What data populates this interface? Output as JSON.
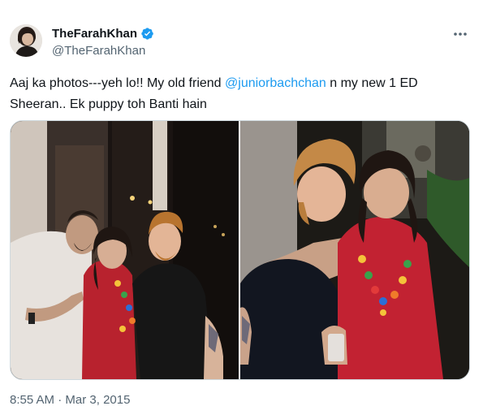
{
  "tweet": {
    "display_name": "TheFarahKhan",
    "handle": "@TheFarahKhan",
    "text_part1": "Aaj ka photos---yeh lo!! My old friend ",
    "mention": "@juniorbachchan",
    "text_part2": " n my new 1 ED Sheeran.. Ek puppy toh Banti hain",
    "time": "8:55 AM",
    "separator": " · ",
    "date": "Mar 3, 2015"
  },
  "icons": {
    "verified": "verified-badge-icon",
    "more": "more-options-icon"
  },
  "colors": {
    "accent": "#1d9bf0",
    "secondary_text": "#536471",
    "primary_text": "#0f1419"
  }
}
